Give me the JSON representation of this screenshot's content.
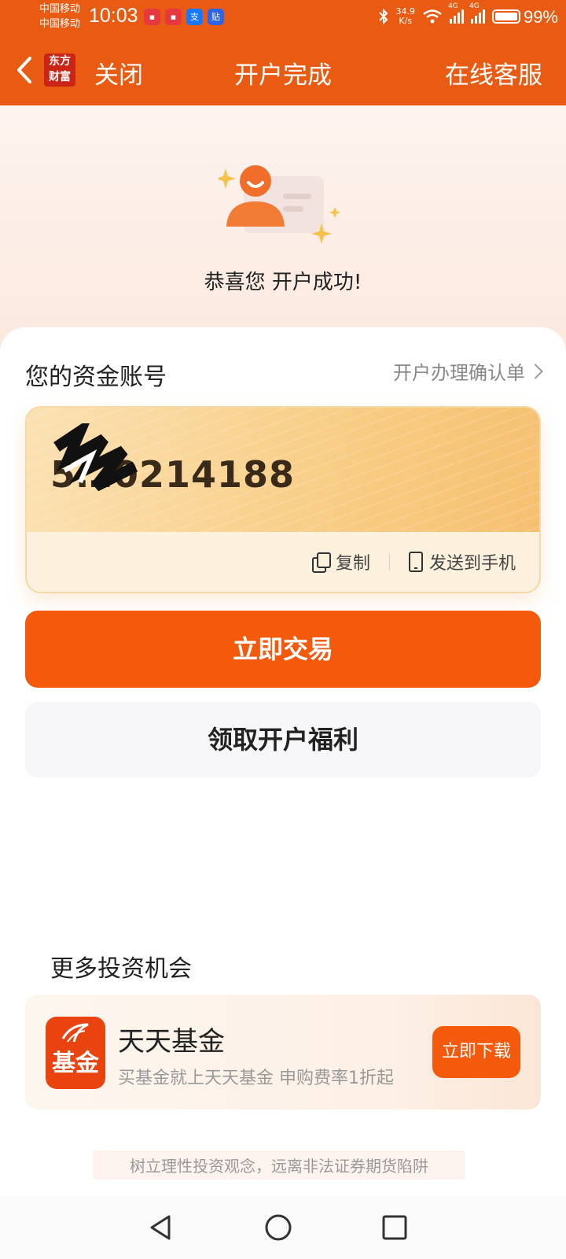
{
  "status_bar": {
    "carrier_1": "中国移动",
    "carrier_2": "中国移动",
    "time": "10:03",
    "net_speed_value": "34.9",
    "net_speed_unit": "K/s",
    "net_type_1": "4G",
    "net_type_2": "4G",
    "battery": "99%",
    "app_icons": [
      "huawei-app-icon",
      "huawei-app-icon",
      "alipay-icon",
      "tieba-icon"
    ]
  },
  "nav": {
    "logo_line_1": "东方",
    "logo_line_2": "财富",
    "close_label": "关闭",
    "title": "开户完成",
    "service_label": "在线客服"
  },
  "hero": {
    "message": "恭喜您 开户成功!"
  },
  "account": {
    "section_title": "您的资金账号",
    "confirm_link": "开户办理确认单",
    "account_number": "5…0214188",
    "copy_label": "复制",
    "send_label": "发送到手机"
  },
  "actions": {
    "trade_label": "立即交易",
    "benefit_label": "领取开户福利"
  },
  "more": {
    "title": "更多投资机会",
    "app_icon_text": "基金",
    "app_name": "天天基金",
    "app_desc": "买基金就上天天基金 申购费率1折起",
    "download_label": "立即下载"
  },
  "footer": {
    "note": "树立理性投资观念，远离非法证券期货陷阱"
  },
  "colors": {
    "brand": "#e95b12",
    "primary_button": "#f55a0c",
    "card_gold": "#f8cd85"
  }
}
